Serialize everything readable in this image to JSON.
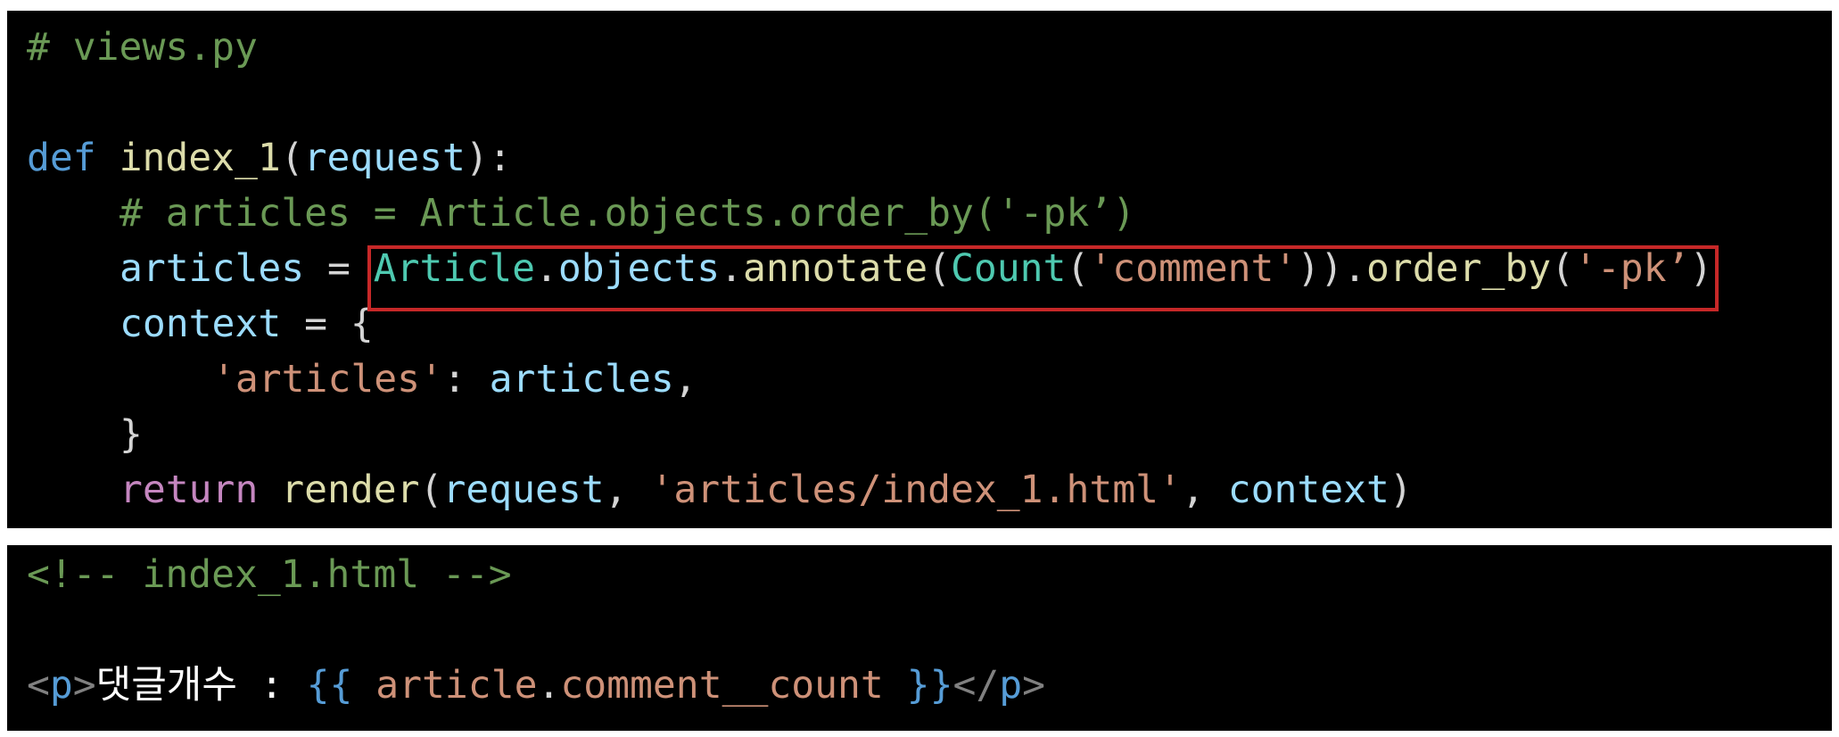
{
  "views_code": {
    "line1": {
      "comment": "# views.py"
    },
    "line3": {
      "kw": "def",
      "space": " ",
      "func": "index_1",
      "open": "(",
      "param": "request",
      "close": "):"
    },
    "line4": {
      "comment": "# articles = Article.objects.order_by('-pk’)"
    },
    "line5": {
      "var": "articles",
      "assign": " = ",
      "cls": "Article",
      "dot1": ".",
      "attr": "objects",
      "dot2": ".",
      "method1": "annotate",
      "open1": "(",
      "func2": "Count",
      "open2": "(",
      "str1": "'comment'",
      "close": ")).",
      "method2": "order_by",
      "open3": "(",
      "str2": "'-pk’",
      "close2": ")"
    },
    "line6": {
      "var": "context",
      "rest": " = {"
    },
    "line7": {
      "str": "'articles'",
      "colon": ": ",
      "var": "articles",
      "comma": ","
    },
    "line8": {
      "brace": "}"
    },
    "line9": {
      "kw": "return",
      "space": " ",
      "func": "render",
      "open": "(",
      "arg1": "request",
      "sep1": ", ",
      "arg2": "'articles/index_1.html'",
      "sep2": ", ",
      "arg3": "context",
      "close": ")"
    }
  },
  "template_code": {
    "line1": {
      "comment": "<!-- index_1.html -->"
    },
    "line3": {
      "lt1": "<",
      "tag1": "p",
      "gt1": ">",
      "text": "댓글개수 : ",
      "open": "{{ ",
      "var": "article",
      "dot": ".",
      "attr": "comment__count",
      "close": " }}",
      "lt2": "</",
      "tag2": "p",
      "gt2": ">"
    }
  },
  "highlight_color": "#c62828"
}
